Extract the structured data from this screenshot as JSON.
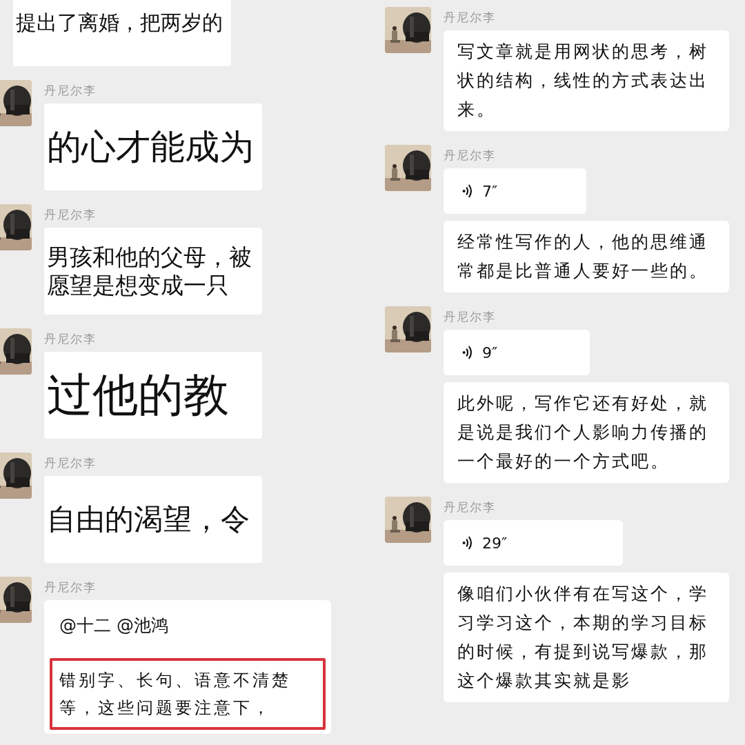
{
  "left_chat": [
    {
      "messages": [
        {
          "kind": "image_text",
          "lines": [
            "提出了离婚，把两岁的"
          ]
        }
      ]
    },
    {
      "sender": "丹尼尔李",
      "messages": [
        {
          "kind": "image_text",
          "lines": [
            "的心才能成为"
          ]
        }
      ]
    },
    {
      "sender": "丹尼尔李",
      "messages": [
        {
          "kind": "image_text",
          "lines": [
            "男孩和他的父母，被",
            "愿望是想变成一只"
          ]
        }
      ]
    },
    {
      "sender": "丹尼尔李",
      "messages": [
        {
          "kind": "image_text",
          "lines": [
            "过他的教"
          ]
        }
      ]
    },
    {
      "sender": "丹尼尔李",
      "messages": [
        {
          "kind": "image_text",
          "lines": [
            "自由的渴望，令"
          ]
        }
      ]
    },
    {
      "sender": "丹尼尔李",
      "messages": [
        {
          "kind": "highlight",
          "mention": "@十二 @池鸿",
          "text": "错别字、长句、语意不清楚等，这些问题要注意下，",
          "color": "#d8343c"
        }
      ]
    }
  ],
  "right_chat": [
    {
      "sender": "丹尼尔李",
      "messages": [
        {
          "kind": "text",
          "text": "写文章就是用网状的思考，树状的结构，线性的方式表达出来。"
        }
      ]
    },
    {
      "sender": "丹尼尔李",
      "messages": [
        {
          "kind": "voice",
          "duration": "7″"
        },
        {
          "kind": "text",
          "text": "经常性写作的人，他的思维通常都是比普通人要好一些的。"
        }
      ]
    },
    {
      "sender": "丹尼尔李",
      "messages": [
        {
          "kind": "voice",
          "duration": "9″"
        },
        {
          "kind": "text",
          "text": "此外呢，写作它还有好处，就是说是我们个人影响力传播的一个最好的一个方式吧。"
        }
      ]
    },
    {
      "sender": "丹尼尔李",
      "messages": [
        {
          "kind": "voice",
          "duration": "29″"
        },
        {
          "kind": "text",
          "text": "像咱们小伙伴有在写这个，学习学习这个，本期的学习目标的时候，有提到说写爆款，那这个爆款其实就是影"
        }
      ]
    }
  ]
}
